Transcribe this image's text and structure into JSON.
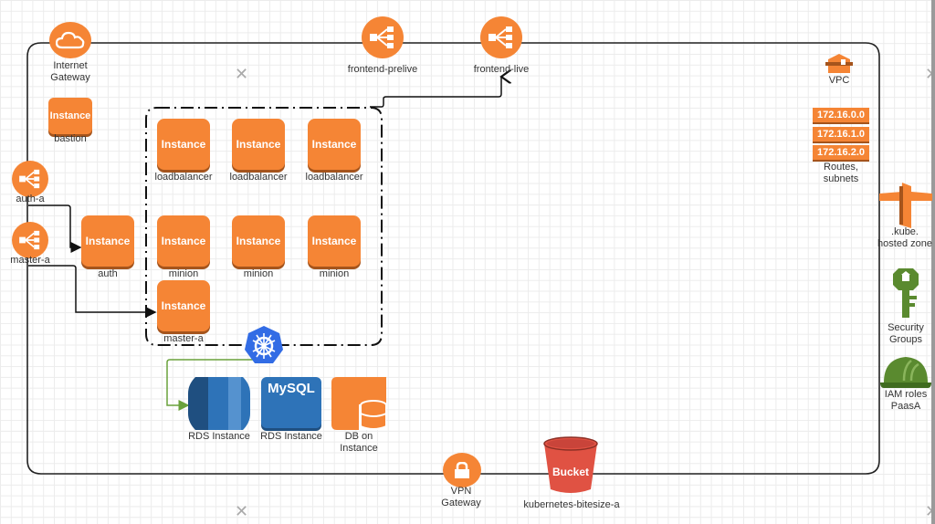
{
  "diagram": {
    "vpc_label": "VPC",
    "internet_gateway": {
      "label_line1": "Internet",
      "label_line2": "Gateway"
    },
    "vpn_gateway": {
      "label_line1": "VPN",
      "label_line2": "Gateway"
    },
    "load_balancers": [
      {
        "label": "frontend-prelive"
      },
      {
        "label": "frontend-live"
      },
      {
        "label": "auth-a"
      },
      {
        "label": "master-a"
      }
    ],
    "instance_text": "Instance",
    "instances": [
      {
        "label": "bastion"
      },
      {
        "label": "loadbalancer"
      },
      {
        "label": "loadbalancer"
      },
      {
        "label": "loadbalancer"
      },
      {
        "label": "auth"
      },
      {
        "label": "minion"
      },
      {
        "label": "minion"
      },
      {
        "label": "minion"
      },
      {
        "label": "master-a"
      }
    ],
    "subnets": [
      "172.16.0.0",
      "172.16.1.0",
      "172.16.2.0"
    ],
    "routes_label_line1": "Routes,",
    "routes_label_line2": "subnets",
    "hosted_zone": {
      "label_line1": ".kube.",
      "label_line2": "hosted zone"
    },
    "security_groups": {
      "label_line1": "Security",
      "label_line2": "Groups"
    },
    "iam_roles": {
      "label_line1": "IAM roles",
      "label_line2": "PaasA"
    },
    "databases": [
      {
        "label": "RDS Instance"
      },
      {
        "label": "RDS Instance",
        "badge": "MySQL"
      },
      {
        "label_line1": "DB on",
        "label_line2": "Instance"
      }
    ],
    "bucket": {
      "badge": "Bucket",
      "label": "kubernetes-bitesize-a"
    },
    "colors": {
      "aws_orange": "#f58535",
      "aws_orange_dark": "#a5541c",
      "rds_blue": "#2e73b8",
      "kubernetes_blue": "#326ce5",
      "security_green": "#5a8a2f",
      "bucket_red": "#e05243",
      "connector_green": "#6aa23c"
    }
  }
}
